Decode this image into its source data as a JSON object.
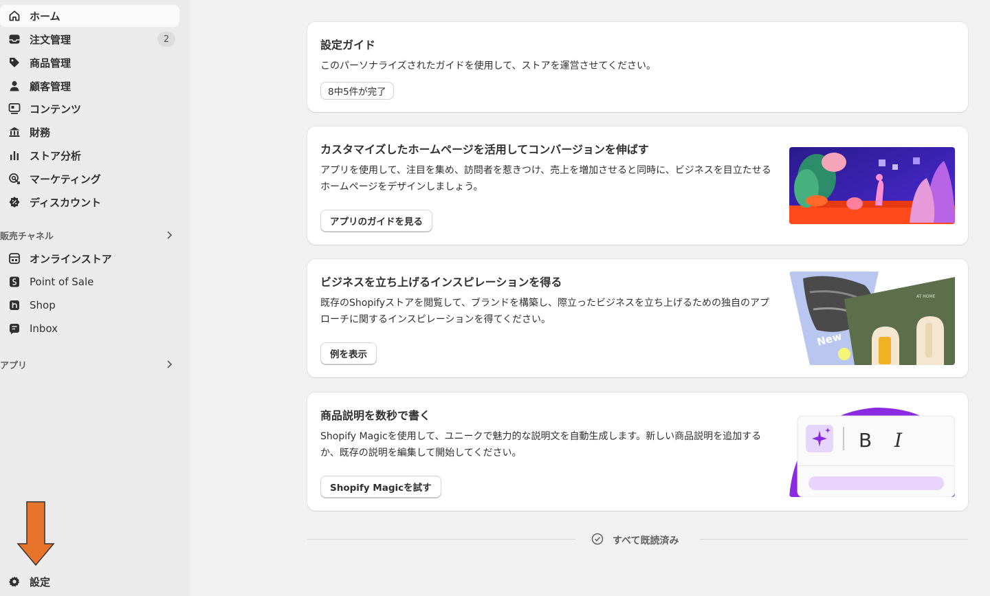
{
  "sidebar": {
    "nav": [
      {
        "label": "ホーム",
        "icon": "home-icon"
      },
      {
        "label": "注文管理",
        "icon": "inbox-icon",
        "badge": "2"
      },
      {
        "label": "商品管理",
        "icon": "tag-icon"
      },
      {
        "label": "顧客管理",
        "icon": "person-icon"
      },
      {
        "label": "コンテンツ",
        "icon": "content-icon"
      },
      {
        "label": "財務",
        "icon": "bank-icon"
      },
      {
        "label": "ストア分析",
        "icon": "bar-chart-icon"
      },
      {
        "label": "マーケティング",
        "icon": "target-icon"
      },
      {
        "label": "ディスカウント",
        "icon": "discount-icon"
      }
    ],
    "sales_channels_heading": "販売チャネル",
    "channels": [
      {
        "label": "オンラインストア",
        "icon": "store-icon"
      },
      {
        "label": "Point of Sale",
        "icon": "pos-icon"
      },
      {
        "label": "Shop",
        "icon": "shop-icon"
      },
      {
        "label": "Inbox",
        "icon": "chat-icon"
      }
    ],
    "apps_heading": "アプリ",
    "settings_label": "設定"
  },
  "cards": {
    "setup_guide": {
      "title": "設定ガイド",
      "text": "このパーソナライズされたガイドを使用して、ストアを運営させてください。",
      "progress": "8中5件が完了"
    },
    "homepage": {
      "title": "カスタマイズしたホームページを活用してコンバージョンを伸ばす",
      "text": "アプリを使用して、注目を集め、訪問者を惹きつけ、売上を増加させると同時に、ビジネスを目立たせるホームページをデザインしましょう。",
      "button": "アプリのガイドを見る"
    },
    "inspiration": {
      "title": "ビジネスを立ち上げるインスピレーションを得る",
      "text": "既存のShopifyストアを閲覧して、ブランドを構築し、際立ったビジネスを立ち上げるための独自のアプローチに関するインスピレーションを得てください。",
      "button": "例を表示",
      "image_text_1": "New",
      "image_text_2": "AT HOME"
    },
    "magic": {
      "title": "商品説明を数秒で書く",
      "text": "Shopify Magicを使用して、ユニークで魅力的な説明文を自動生成します。新しい商品説明を追加するか、既存の説明を編集して開始してください。",
      "button": "Shopify Magicを試す",
      "bold_glyph": "B",
      "italic_glyph": "I"
    }
  },
  "footer": {
    "all_read": "すべて既読済み"
  },
  "colors": {
    "accent_arrow": "#e8732a",
    "magic_purple": "#8a2be2"
  }
}
